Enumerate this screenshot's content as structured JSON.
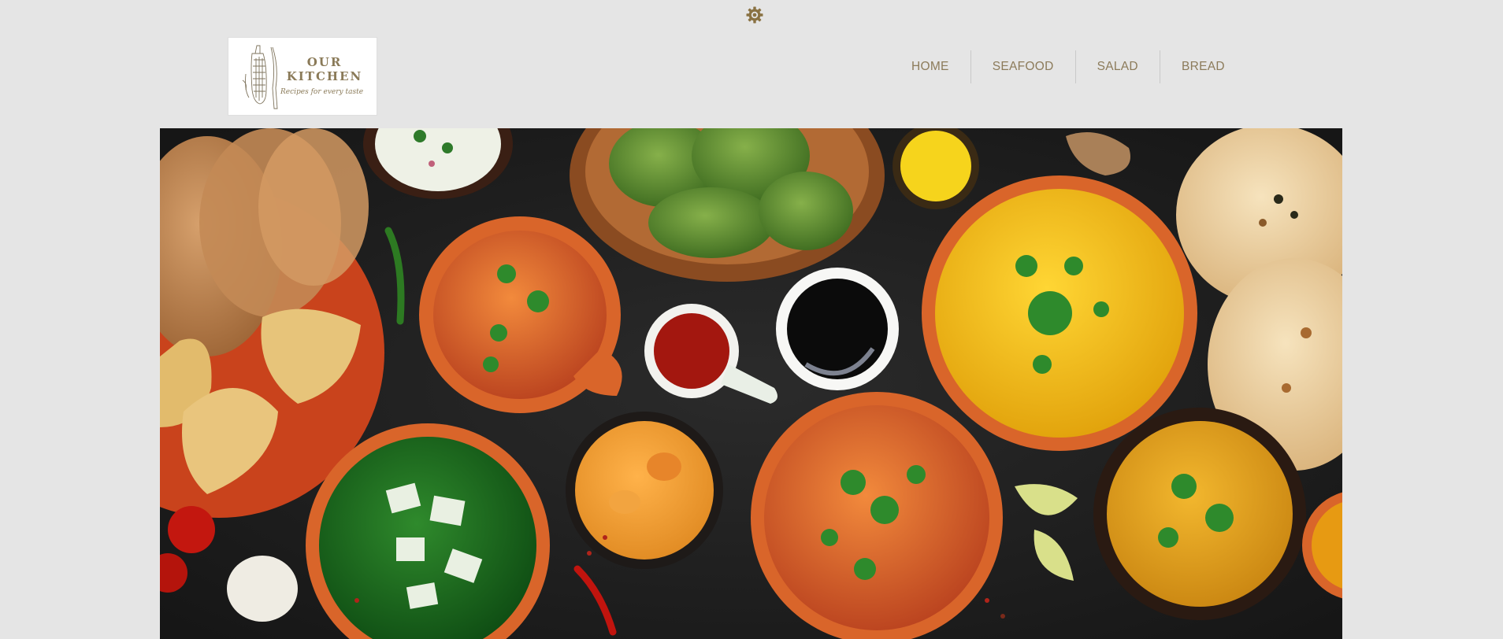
{
  "header": {
    "settings_icon": "gear-icon",
    "logo": {
      "title_line1": "OUR",
      "title_line2": "KITCHEN",
      "tagline": "Recipes for every taste"
    },
    "nav": [
      {
        "label": "HOME"
      },
      {
        "label": "SEAFOOD"
      },
      {
        "label": "SALAD"
      },
      {
        "label": "BREAD"
      }
    ]
  },
  "colors": {
    "background": "#e5e5e5",
    "accent": "#8c7b5a",
    "gear": "#8a7243"
  },
  "hero": {
    "image": "indian-food-spread-image"
  }
}
